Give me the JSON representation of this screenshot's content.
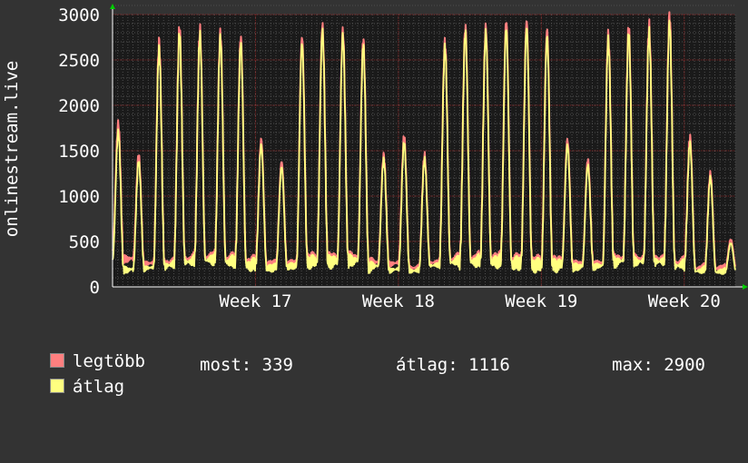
{
  "chart_data": {
    "type": "line",
    "ylabel": "onlinestream.live",
    "ylim": [
      0,
      3000
    ],
    "yticks": [
      0,
      500,
      1000,
      1500,
      2000,
      2500,
      3000
    ],
    "xticks": [
      {
        "label": "Week 17",
        "day": 7
      },
      {
        "label": "Week 18",
        "day": 14
      },
      {
        "label": "Week 19",
        "day": 21
      },
      {
        "label": "Week 20",
        "day": 28
      }
    ],
    "x_range_days": [
      0,
      30.5
    ],
    "grid": true,
    "series": [
      {
        "name": "legtöbb",
        "color": "#ff7f7f",
        "daily_peaks": [
          1800,
          1450,
          2700,
          2850,
          2830,
          2800,
          2750,
          1620,
          1380,
          2750,
          2880,
          2820,
          2720,
          1450,
          1650,
          1450,
          2700,
          2860,
          2860,
          2930,
          2930,
          2830,
          1620,
          1400,
          2780,
          2850,
          2880,
          2990,
          1650,
          1250,
          520
        ],
        "daily_troughs": [
          400,
          300,
          250,
          260,
          300,
          320,
          300,
          260,
          240,
          250,
          300,
          300,
          310,
          260,
          250,
          200,
          260,
          300,
          300,
          300,
          280,
          260,
          260,
          240,
          250,
          300,
          300,
          300,
          260,
          200,
          200
        ]
      },
      {
        "name": "átlag",
        "color": "#ffff80",
        "daily_peaks": [
          1700,
          1380,
          2620,
          2780,
          2760,
          2740,
          2680,
          1560,
          1320,
          2680,
          2820,
          2760,
          2660,
          1400,
          1580,
          1400,
          2640,
          2800,
          2800,
          2850,
          2850,
          2750,
          1560,
          1340,
          2720,
          2780,
          2800,
          2900,
          1580,
          1200,
          480
        ],
        "daily_troughs": [
          300,
          180,
          200,
          230,
          270,
          290,
          270,
          230,
          200,
          220,
          270,
          270,
          280,
          220,
          180,
          170,
          230,
          270,
          270,
          270,
          250,
          230,
          230,
          210,
          220,
          270,
          270,
          270,
          230,
          170,
          160
        ]
      }
    ]
  },
  "legend": {
    "max_label": "legtöbb",
    "avg_label": "átlag",
    "max_color": "#ff7f7f",
    "avg_color": "#ffff80",
    "now_text": "most: 339",
    "avg_text": "átlag: 1116",
    "max_text": "max: 2900"
  },
  "colors": {
    "background": "#333333",
    "plot_background": "#1a1a1a",
    "grid_major": "#7f1f1f",
    "grid_minor": "#4d4d4d",
    "axis": "#ffffff",
    "arrow": "#00cc00"
  }
}
